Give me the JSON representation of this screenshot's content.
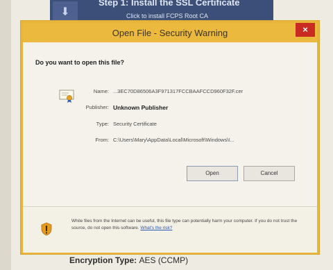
{
  "background": {
    "banner_title": "Step 1: Install the SSL Certificate",
    "banner_subtitle": "Click to install FCPS Root CA",
    "encryption_label": "Encryption Type:",
    "encryption_value": "AES (CCMP)"
  },
  "dialog": {
    "title": "Open File - Security Warning",
    "close_label": "×",
    "question": "Do you want to open this file?",
    "fields": {
      "name_label": "Name:",
      "name_value": "...3EC70D86506A3F971317FCCBAAFCCD960F32F.cer",
      "publisher_label": "Publisher:",
      "publisher_value": "Unknown Publisher",
      "type_label": "Type:",
      "type_value": "Security Certificate",
      "from_label": "From:",
      "from_value": "C:\\Users\\Mary\\AppData\\Local\\Microsoft\\Windows\\I..."
    },
    "open_label": "Open",
    "cancel_label": "Cancel",
    "warning_text": "While files from the Internet can be useful, this file type can potentially harm your computer. If you do not trust the source, do not open this software.",
    "warning_link": "What's the risk?"
  },
  "colors": {
    "title_bar": "#eab93e",
    "close_button": "#c92a22",
    "banner": "#3c4f78"
  }
}
